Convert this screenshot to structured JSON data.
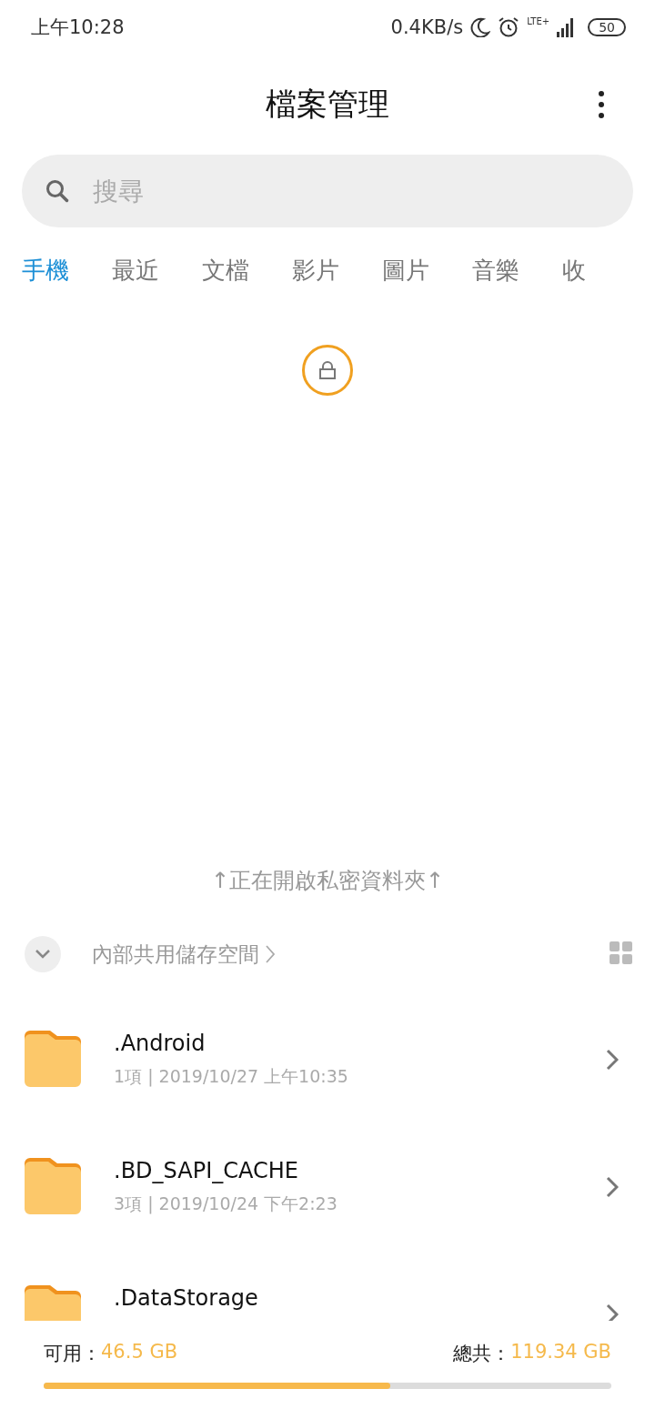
{
  "status_bar": {
    "time": "上午10:28",
    "speed": "0.4KB/s",
    "network": "LTE+",
    "battery": "50"
  },
  "title": "檔案管理",
  "search": {
    "placeholder": "搜尋"
  },
  "tabs": [
    {
      "label": "手機",
      "selected": true
    },
    {
      "label": "最近",
      "selected": false
    },
    {
      "label": "文檔",
      "selected": false
    },
    {
      "label": "影片",
      "selected": false
    },
    {
      "label": "圖片",
      "selected": false
    },
    {
      "label": "音樂",
      "selected": false
    },
    {
      "label": "收",
      "selected": false
    }
  ],
  "private_hint": "↑正在開啟私密資料夾↑",
  "storage": {
    "label": "內部共用儲存空間"
  },
  "folders": [
    {
      "name": ".Android",
      "meta": "1項 | 2019/10/27 上午10:35"
    },
    {
      "name": ".BD_SAPI_CACHE",
      "meta": "3項 | 2019/10/24 下午2:23"
    },
    {
      "name": ".DataStorage"
    }
  ],
  "footer": {
    "available_label": "可用：",
    "available": "46.5 GB",
    "total_label": "總共：",
    "total": "119.34 GB",
    "level": 0.61
  }
}
